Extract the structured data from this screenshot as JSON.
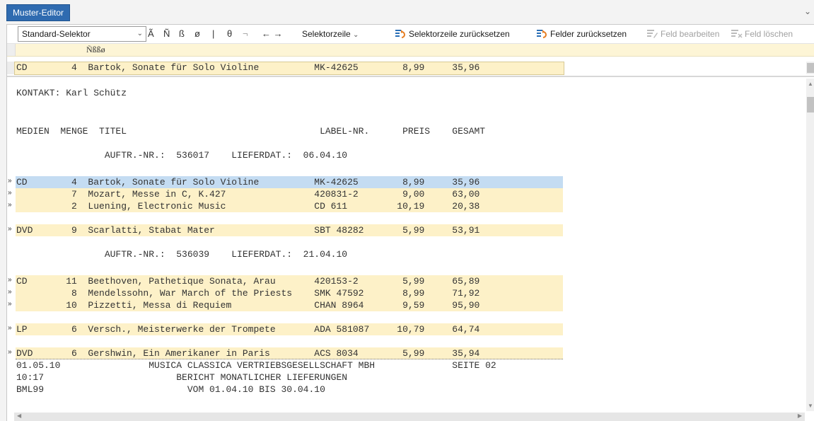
{
  "tab": {
    "title": "Muster-Editor"
  },
  "toolbar": {
    "selector_value": "Standard-Selektor",
    "char_a": "Ã",
    "char_n": "Ñ",
    "char_ss": "ß",
    "char_o": "ø",
    "pipe": "|",
    "theta": "θ",
    "neg": "¬",
    "arrows": "← →",
    "selektorzeile": "Selektorzeile",
    "reset_row": "Selektorzeile zurücksetzen",
    "reset_fields": "Felder zurücksetzen",
    "edit_field": "Feld bearbeiten",
    "delete_field": "Feld löschen"
  },
  "ruler": {
    "text": "Ñßßø"
  },
  "fixed_row": {
    "text": "CD        4  Bartok, Sonate für Solo Violine          MK-42625        8,99     35,96"
  },
  "lines": [
    {
      "text": "KONTAKT: Karl Schütz",
      "marker": "",
      "band": ""
    },
    {
      "text": "MEDIEN  MENGE  TITEL                                   LABEL-NR.      PREIS    GESAMT",
      "marker": "",
      "band": ""
    },
    {
      "text": "                AUFTR.-NR.:  536017    LIEFERDAT.:  06.04.10",
      "marker": "",
      "band": ""
    },
    {
      "text": "CD        4  Bartok, Sonate für Solo Violine          MK-42625        8,99     35,96",
      "marker": "»",
      "band": "blue"
    },
    {
      "text": "          7  Mozart, Messe in C, K.427                420831-2        9,00     63,00",
      "marker": "»",
      "band": "yellow"
    },
    {
      "text": "          2  Luening, Electronic Music                CD 611         10,19     20,38",
      "marker": "»",
      "band": "yellow"
    },
    {
      "text": "DVD       9  Scarlatti, Stabat Mater                  SBT 48282       5,99     53,91",
      "marker": "»",
      "band": "yellow"
    },
    {
      "text": "                AUFTR.-NR.:  536039    LIEFERDAT.:  21.04.10",
      "marker": "",
      "band": ""
    },
    {
      "text": "CD       11  Beethoven, Pathetique Sonata, Arau       420153-2        5,99     65,89",
      "marker": "»",
      "band": "yellow"
    },
    {
      "text": "          8  Mendelssohn, War March of the Priests    SMK 47592       8,99     71,92",
      "marker": "»",
      "band": "yellow"
    },
    {
      "text": "         10  Pizzetti, Messa di Requiem               CHAN 8964       9,59     95,90",
      "marker": "»",
      "band": "yellow"
    },
    {
      "text": "LP        6  Versch., Meisterwerke der Trompete       ADA 581087     10,79     64,74",
      "marker": "»",
      "band": "yellow"
    },
    {
      "text": "DVD       6  Gershwin, Ein Amerikaner in Paris        ACS 8034        5,99     35,94",
      "marker": "»",
      "band": "yellow"
    },
    {
      "text": "01.05.10                MUSICA CLASSICA VERTRIEBSGESELLSCHAFT MBH              SEITE 02",
      "marker": "",
      "band": ""
    },
    {
      "text": "10:17                        BERICHT MONATLICHER LIEFERUNGEN",
      "marker": "",
      "band": ""
    },
    {
      "text": "BML99                          VOM 01.04.10 BIS 30.04.10",
      "marker": "",
      "band": ""
    }
  ]
}
